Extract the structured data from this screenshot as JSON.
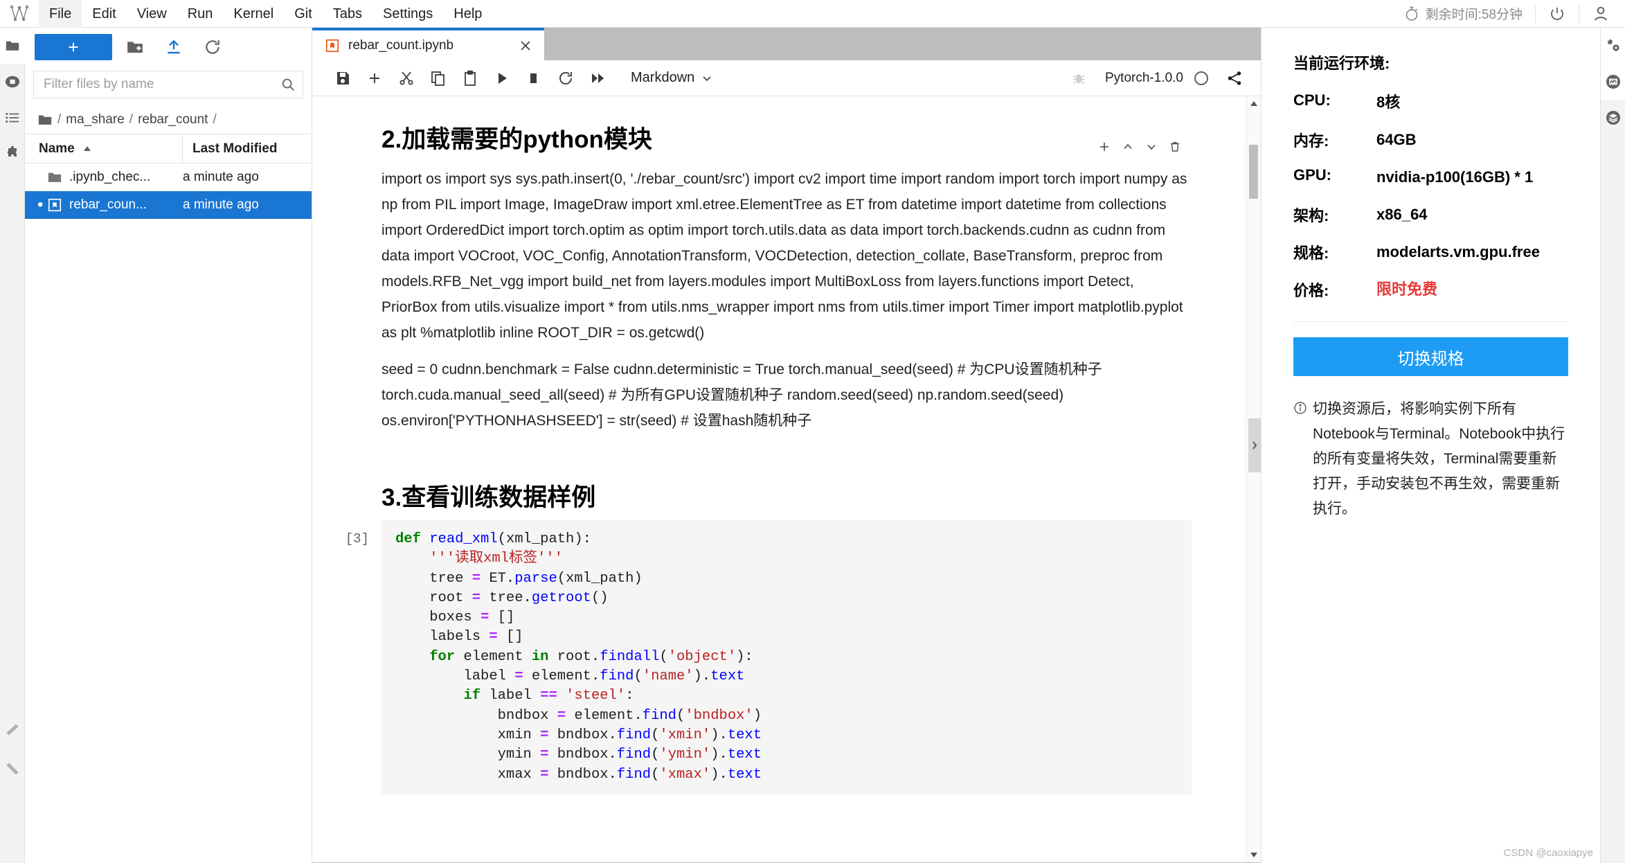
{
  "menubar": {
    "logo_name": "jupyterlab-logo",
    "items": [
      {
        "label": "File",
        "active": true
      },
      {
        "label": "Edit",
        "active": false
      },
      {
        "label": "View",
        "active": false
      },
      {
        "label": "Run",
        "active": false
      },
      {
        "label": "Kernel",
        "active": false
      },
      {
        "label": "Git",
        "active": false
      },
      {
        "label": "Tabs",
        "active": false
      },
      {
        "label": "Settings",
        "active": false
      },
      {
        "label": "Help",
        "active": false
      }
    ],
    "timer_text": "剩余时间:58分钟",
    "timer_icon": "stopwatch-icon",
    "power_icon": "power-icon",
    "user_icon": "user-account-icon"
  },
  "left_rail": {
    "items": [
      {
        "name": "file-browser",
        "icon": "folder-icon",
        "selected": true
      },
      {
        "name": "running-terminals",
        "icon": "stop-circle-icon",
        "selected": false
      },
      {
        "name": "commands",
        "icon": "list-icon",
        "selected": false
      },
      {
        "name": "extensions",
        "icon": "puzzle-icon",
        "selected": false
      }
    ],
    "bottom_items": [
      {
        "name": "collapse-chevron-upper",
        "icon": "chevron-left-icon"
      },
      {
        "name": "collapse-chevron-lower",
        "icon": "chevron-left-icon"
      }
    ]
  },
  "filebrowser": {
    "toolbar": {
      "new_launcher_label": "+",
      "new_folder_icon": "new-folder-icon",
      "upload_icon": "upload-icon",
      "refresh_icon": "refresh-icon"
    },
    "filter": {
      "placeholder": "Filter files by name",
      "value": "",
      "search_icon": "search-icon"
    },
    "breadcrumb": {
      "root_icon": "folder-icon",
      "segments": [
        "ma_share",
        "rebar_count"
      ]
    },
    "columns": {
      "name": "Name",
      "last_modified": "Last Modified",
      "sort_icon": "sort-ascending-icon"
    },
    "rows": [
      {
        "name": ".ipynb_chec...",
        "modified": "a minute ago",
        "icon": "folder-icon",
        "selected": false,
        "dirty": false
      },
      {
        "name": "rebar_coun...",
        "modified": "a minute ago",
        "icon": "notebook-icon",
        "selected": true,
        "dirty": true
      }
    ]
  },
  "notebook": {
    "tab": {
      "title": "rebar_count.ipynb",
      "icon": "notebook-icon",
      "close_icon": "close-icon"
    },
    "toolbar": {
      "save_icon": "save-icon",
      "insert_icon": "plus-icon",
      "cut_icon": "scissors-icon",
      "copy_icon": "copy-icon",
      "paste_icon": "paste-icon",
      "run_icon": "play-icon",
      "stop_icon": "stop-square-icon",
      "restart_icon": "restart-icon",
      "restart_run_all_icon": "fast-forward-icon",
      "celltype_value": "Markdown",
      "celltype_chevron": "chevron-down-icon",
      "debugger_icon": "bug-icon",
      "kernel_name": "Pytorch-1.0.0",
      "kernel_status_icon": "kernel-idle-circle",
      "share_icon": "share-icon"
    },
    "cell_toolbar": {
      "add_icon": "plus-icon",
      "move_up_icon": "chevron-up-icon",
      "move_down_icon": "chevron-down-icon",
      "delete_icon": "trash-icon"
    },
    "cells": [
      {
        "type": "markdown",
        "heading": "2.加载需要的python模块",
        "paragraphs": [
          "import os import sys sys.path.insert(0, './rebar_count/src') import cv2 import time import random import torch import numpy as np from PIL import Image, ImageDraw import xml.etree.ElementTree as ET from datetime import datetime from collections import OrderedDict import torch.optim as optim import torch.utils.data as data import torch.backends.cudnn as cudnn from data import VOCroot, VOC_Config, AnnotationTransform, VOCDetection, detection_collate, BaseTransform, preproc from models.RFB_Net_vgg import build_net from layers.modules import MultiBoxLoss from layers.functions import Detect, PriorBox from utils.visualize import * from utils.nms_wrapper import nms from utils.timer import Timer import matplotlib.pyplot as plt %matplotlib inline ROOT_DIR = os.getcwd()",
          "seed = 0 cudnn.benchmark = False cudnn.deterministic = True torch.manual_seed(seed) # 为CPU设置随机种子 torch.cuda.manual_seed_all(seed) # 为所有GPU设置随机种子 random.seed(seed) np.random.seed(seed) os.environ['PYTHONHASHSEED'] = str(seed) # 设置hash随机种子"
        ]
      },
      {
        "type": "markdown",
        "heading": "3.查看训练数据样例",
        "paragraphs": []
      },
      {
        "type": "code",
        "prompt": "[3]",
        "lines": [
          [
            {
              "t": "def ",
              "c": "k"
            },
            {
              "t": "read_xml",
              "c": "fn"
            },
            {
              "t": "(xml_path):",
              "c": ""
            }
          ],
          [
            {
              "t": "    '''读取xml标签'''",
              "c": "doc"
            }
          ],
          [
            {
              "t": "    tree ",
              "c": ""
            },
            {
              "t": "=",
              "c": "op"
            },
            {
              "t": " ET.",
              "c": ""
            },
            {
              "t": "parse",
              "c": "mth"
            },
            {
              "t": "(xml_path)",
              "c": ""
            }
          ],
          [
            {
              "t": "    root ",
              "c": ""
            },
            {
              "t": "=",
              "c": "op"
            },
            {
              "t": " tree.",
              "c": ""
            },
            {
              "t": "getroot",
              "c": "mth"
            },
            {
              "t": "()",
              "c": ""
            }
          ],
          [
            {
              "t": "    boxes ",
              "c": ""
            },
            {
              "t": "=",
              "c": "op"
            },
            {
              "t": " []",
              "c": ""
            }
          ],
          [
            {
              "t": "    labels ",
              "c": ""
            },
            {
              "t": "=",
              "c": "op"
            },
            {
              "t": " []",
              "c": ""
            }
          ],
          [
            {
              "t": "    for ",
              "c": "k"
            },
            {
              "t": "element ",
              "c": ""
            },
            {
              "t": "in ",
              "c": "k"
            },
            {
              "t": "root.",
              "c": ""
            },
            {
              "t": "findall",
              "c": "mth"
            },
            {
              "t": "(",
              "c": ""
            },
            {
              "t": "'object'",
              "c": "st"
            },
            {
              "t": "):",
              "c": ""
            }
          ],
          [
            {
              "t": "        label ",
              "c": ""
            },
            {
              "t": "=",
              "c": "op"
            },
            {
              "t": " element.",
              "c": ""
            },
            {
              "t": "find",
              "c": "mth"
            },
            {
              "t": "(",
              "c": ""
            },
            {
              "t": "'name'",
              "c": "st"
            },
            {
              "t": ").",
              "c": ""
            },
            {
              "t": "text",
              "c": "mth"
            }
          ],
          [
            {
              "t": "        if ",
              "c": "k"
            },
            {
              "t": "label ",
              "c": ""
            },
            {
              "t": "==",
              "c": "op"
            },
            {
              "t": " ",
              "c": ""
            },
            {
              "t": "'steel'",
              "c": "st"
            },
            {
              "t": ":",
              "c": ""
            }
          ],
          [
            {
              "t": "            bndbox ",
              "c": ""
            },
            {
              "t": "=",
              "c": "op"
            },
            {
              "t": " element.",
              "c": ""
            },
            {
              "t": "find",
              "c": "mth"
            },
            {
              "t": "(",
              "c": ""
            },
            {
              "t": "'bndbox'",
              "c": "st"
            },
            {
              "t": ")",
              "c": ""
            }
          ],
          [
            {
              "t": "            xmin ",
              "c": ""
            },
            {
              "t": "=",
              "c": "op"
            },
            {
              "t": " bndbox.",
              "c": ""
            },
            {
              "t": "find",
              "c": "mth"
            },
            {
              "t": "(",
              "c": ""
            },
            {
              "t": "'xmin'",
              "c": "st"
            },
            {
              "t": ").",
              "c": ""
            },
            {
              "t": "text",
              "c": "mth"
            }
          ],
          [
            {
              "t": "            ymin ",
              "c": ""
            },
            {
              "t": "=",
              "c": "op"
            },
            {
              "t": " bndbox.",
              "c": ""
            },
            {
              "t": "find",
              "c": "mth"
            },
            {
              "t": "(",
              "c": ""
            },
            {
              "t": "'ymin'",
              "c": "st"
            },
            {
              "t": ").",
              "c": ""
            },
            {
              "t": "text",
              "c": "mth"
            }
          ],
          [
            {
              "t": "            xmax ",
              "c": ""
            },
            {
              "t": "=",
              "c": "op"
            },
            {
              "t": " bndbox.",
              "c": ""
            },
            {
              "t": "find",
              "c": "mth"
            },
            {
              "t": "(",
              "c": ""
            },
            {
              "t": "'xmax'",
              "c": "st"
            },
            {
              "t": ").",
              "c": ""
            },
            {
              "t": "text",
              "c": "mth"
            }
          ]
        ]
      }
    ],
    "scroll": {
      "up_icon": "scroll-up-arrow",
      "down_icon": "scroll-down-arrow"
    }
  },
  "right_panel": {
    "title": "当前运行环境:",
    "specs": [
      {
        "label": "CPU:",
        "value": "8核",
        "accent": false
      },
      {
        "label": "内存:",
        "value": "64GB",
        "accent": false
      },
      {
        "label": "GPU:",
        "value": "nvidia-p100(16GB) * 1",
        "accent": false
      },
      {
        "label": "架构:",
        "value": "x86_64",
        "accent": false
      },
      {
        "label": "规格:",
        "value": "modelarts.vm.gpu.free",
        "accent": false
      },
      {
        "label": "价格:",
        "value": "限时免费",
        "accent": true
      }
    ],
    "switch_button": "切换规格",
    "note_icon": "info-circle-icon",
    "note": "切换资源后，将影响实例下所有Notebook与Terminal。Notebook中执行的所有变量将失效，Terminal需要重新打开，手动安装包不再生效，需要重新执行。",
    "accent_color": "#e53935",
    "button_color": "#1e9cf5"
  },
  "right_rail": {
    "items": [
      {
        "name": "property-inspector",
        "icon": "gears-icon",
        "selected": true
      },
      {
        "name": "resource-monitor",
        "icon": "monitor-chart-icon",
        "selected": true
      },
      {
        "name": "layers-panel",
        "icon": "layers-icon",
        "selected": false
      }
    ]
  },
  "collapse_handle_icon": "chevron-right-icon",
  "watermark": "CSDN @caoxiapye"
}
